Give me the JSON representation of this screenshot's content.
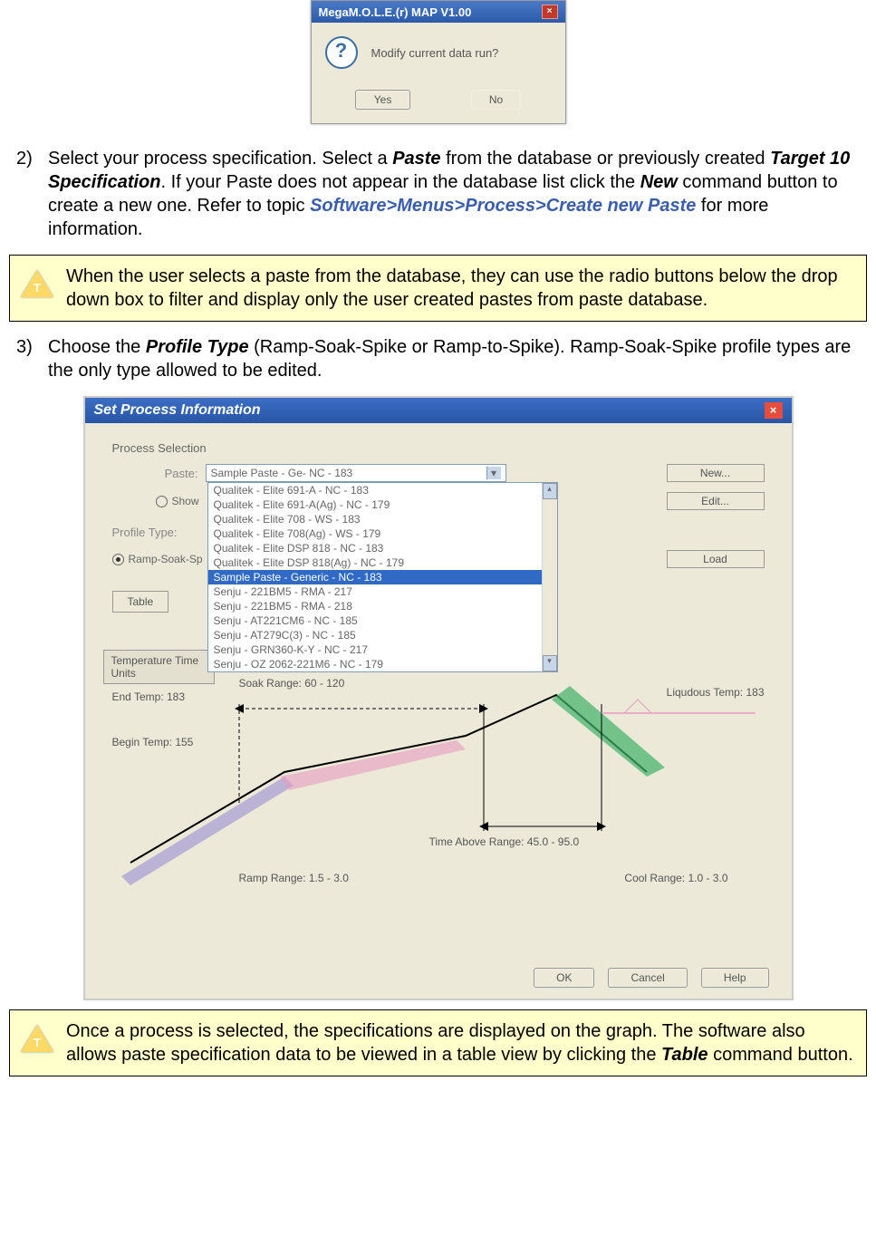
{
  "dialog1": {
    "title": "MegaM.O.L.E.(r) MAP V1.00",
    "message": "Modify current data run?",
    "yes": "Yes",
    "no": "No"
  },
  "step2": {
    "num": "2)",
    "t1": "Select your process specification. Select a ",
    "b1": "Paste",
    "t2": " from the database or previously created ",
    "b2": "Target 10 Specification",
    "t3": ". If your Paste does not appear in the database list click the ",
    "b3": "New",
    "t4": " command button to create a new one. Refer to topic ",
    "link": "Software>Menus>Process>Create new Paste",
    "t5": " for more information."
  },
  "note1": "When the user selects a paste from the database, they can use the radio buttons below the drop down box to filter and display only the user created pastes from paste database.",
  "step3": {
    "num": "3)",
    "t1": "Choose the ",
    "b1": "Profile Type",
    "t2": " (Ramp-Soak-Spike or Ramp-to-Spike). Ramp-Soak-Spike profile types are the only type allowed to be edited."
  },
  "dialog2": {
    "title": "Set Process Information",
    "section": "Process Selection",
    "paste_label": "Paste:",
    "paste_value": "Sample Paste - Ge- NC - 183",
    "show_label": "Show",
    "profile_type_label": "Profile Type:",
    "ramp_radio": "Ramp-Soak-Sp",
    "new_btn": "New...",
    "edit_btn": "Edit...",
    "load_btn": "Load",
    "table_btn": "Table",
    "temp_tab": "Temperature Time Units",
    "items": [
      "Qualitek - Elite 691-A - NC - 183",
      "Qualitek - Elite 691-A(Ag) - NC - 179",
      "Qualitek - Elite 708 - WS - 183",
      "Qualitek - Elite 708(Ag) - WS - 179",
      "Qualitek - Elite DSP 818 - NC - 183",
      "Qualitek - Elite DSP 818(Ag) - NC - 179",
      "Sample Paste - Generic - NC - 183",
      "Senju - 221BM5 - RMA - 217",
      "Senju - 221BM5 - RMA - 218",
      "Senju - AT221CM6 - NC - 185",
      "Senju - AT279C(3) - NC - 185",
      "Senju - GRN360-K-Y - NC - 217",
      "Senju - OZ 2062-221M6 - NC - 179"
    ],
    "end_temp": "End Temp: 183",
    "begin_temp": "Begin Temp: 155",
    "soak_range": "Soak Range: 60 - 120",
    "liquidous": "Liqudous Temp: 183",
    "time_above": "Time Above Range: 45.0 - 95.0",
    "ramp_range": "Ramp Range: 1.5 - 3.0",
    "cool_range": "Cool Range: 1.0 - 3.0",
    "ok": "OK",
    "cancel": "Cancel",
    "help": "Help"
  },
  "note2": {
    "t1": "Once a process is selected, the specifications are displayed on the graph. The software also allows paste specification data to be viewed in a table view by clicking the ",
    "b1": "Table",
    "t2": " command button."
  }
}
